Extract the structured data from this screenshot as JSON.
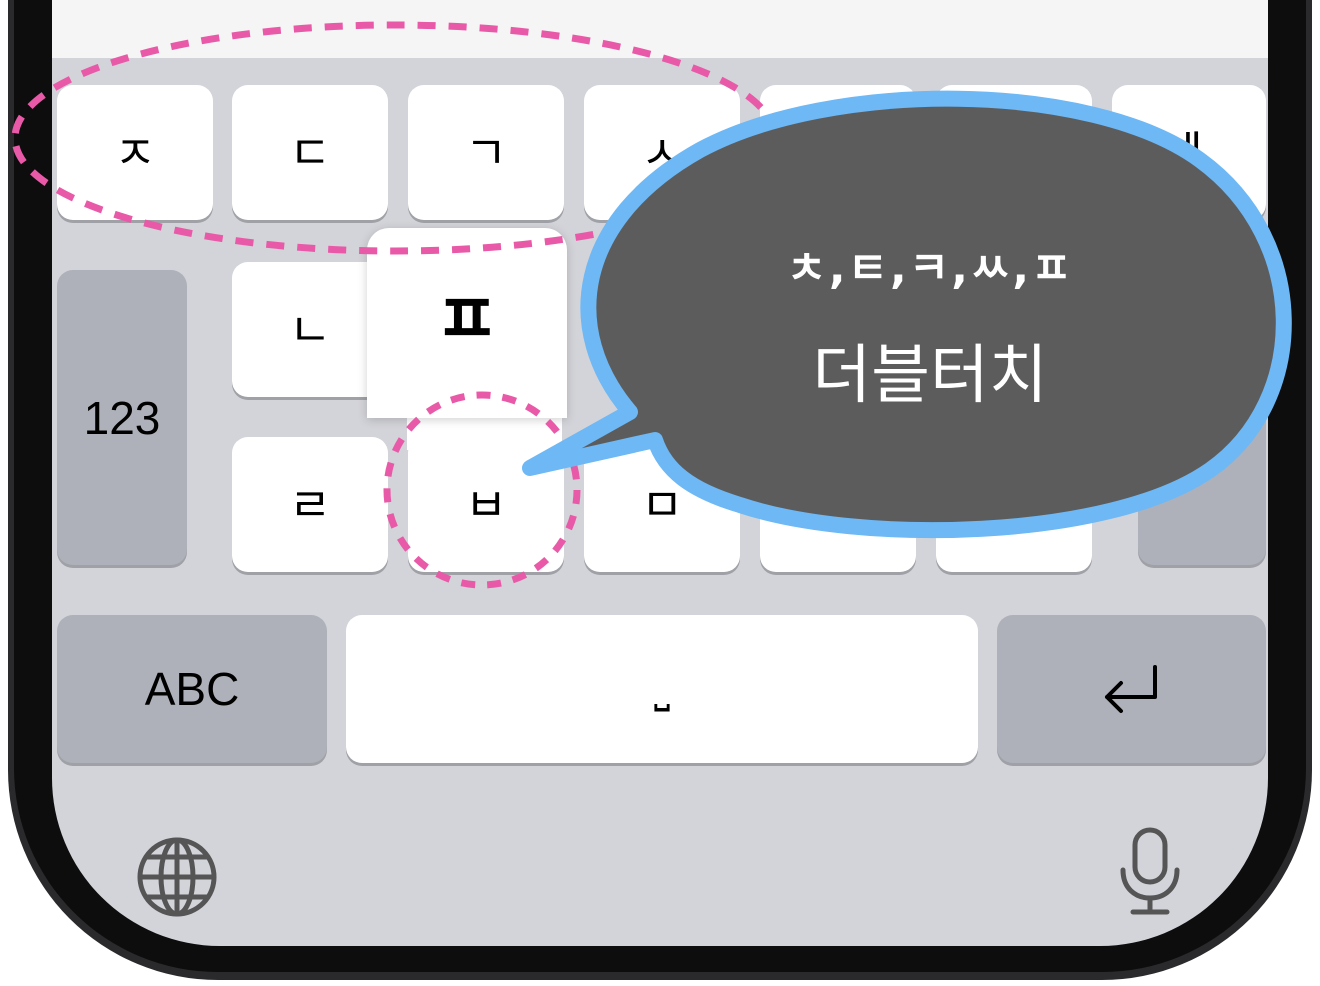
{
  "keyboard": {
    "row1": [
      "ㅈ",
      "ㄷ",
      "ㄱ",
      "ㅅ",
      "",
      "",
      "ㅔ"
    ],
    "row2": [
      "ㄴ",
      "ㅍ"
    ],
    "row3": [
      "ㄹ",
      "ㅂ",
      "ㅁ"
    ],
    "numbers_key": "123",
    "abc_key": "ABC",
    "space_key": "⎵",
    "return_icon": "return-icon",
    "globe_icon": "globe-icon",
    "mic_icon": "microphone-icon"
  },
  "popup": {
    "char": "ㅍ"
  },
  "callout": {
    "line1": "ㅊ,ㅌ,ㅋ,ㅆ,ㅍ",
    "line2": "더블터치"
  },
  "colors": {
    "callout_fill": "#5c5c5c",
    "callout_border": "#6db8f5",
    "highlight_dash": "#e85aa8",
    "keyboard_bg": "#d3d4d9"
  }
}
